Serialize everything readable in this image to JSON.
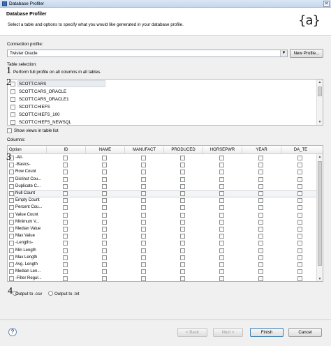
{
  "window": {
    "title": "Database Profiler",
    "close_glyph": "✕"
  },
  "header": {
    "title": "Database Profiler",
    "description": "Select a table and options to specify what you would like generated in your database profile.",
    "logo_text": "{a}"
  },
  "connection": {
    "label": "Connection profile:",
    "value": "Twister Oracle",
    "new_profile_label": "New Profile..."
  },
  "table_selection": {
    "label": "Table selection:",
    "full_profile_label": "Perform full profile on all columns in all tables.",
    "tables": [
      "SCOTT.CARS",
      "SCOTT.CARS_ORACLE",
      "SCOTT.CARS_ORACLE1",
      "SCOTT.CHIEFS",
      "SCOTT.CHIEFS_100",
      "SCOTT.CHIEFS_NEWSQL"
    ],
    "selected_table": "SCOTT.CARS",
    "show_views_label": "Show views in table list"
  },
  "columns": {
    "label": "Columns:",
    "headers": [
      "Option",
      "ID",
      "NAME",
      "MANUFACT",
      "PRODUCED",
      "HORSEPWR",
      "YEAR",
      "DA_TE"
    ],
    "options": [
      "-All-",
      "-Basics-",
      "Row Count",
      "Distinct Cou...",
      "Duplicate C...",
      "Null Count",
      "Empty Count",
      "Percent Cou...",
      "Value Count",
      "Minimum V...",
      "Median Value",
      "Max Value",
      "-Lengths-",
      "Min Length",
      "Max Length",
      "Avg. Length",
      "Median Len...",
      "-Filter Regul..."
    ],
    "selected_option": "Null Count"
  },
  "output": {
    "csv_label": "Output to .csv",
    "txt_label": "Output to .txt"
  },
  "annotations": [
    "1",
    "2",
    "3",
    "4"
  ],
  "footer": {
    "help_glyph": "?",
    "back_label": "< Back",
    "next_label": "Next >",
    "finish_label": "Finish",
    "cancel_label": "Cancel"
  },
  "scroll_arrows": {
    "up": "▲",
    "down": "▼"
  },
  "combo_arrow": "▼"
}
